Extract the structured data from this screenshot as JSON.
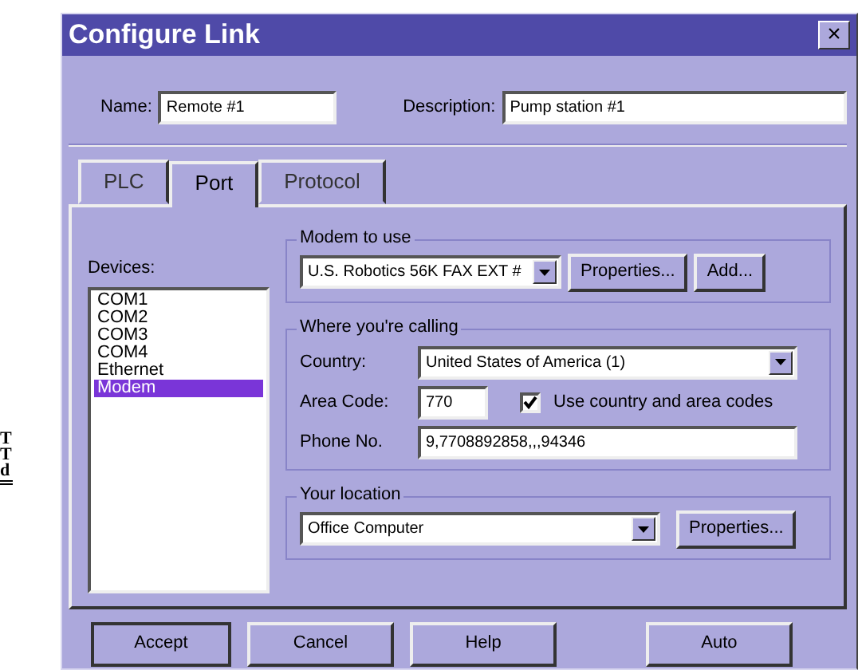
{
  "background_fragments": [
    "T",
    "T",
    "d"
  ],
  "window": {
    "title": "Configure Link",
    "close": "×"
  },
  "name": {
    "label": "Name:",
    "value": "Remote #1"
  },
  "description": {
    "label": "Description:",
    "value": "Pump station #1"
  },
  "tabs": [
    {
      "label": "PLC",
      "selected": false
    },
    {
      "label": "Port",
      "selected": true
    },
    {
      "label": "Protocol",
      "selected": false
    }
  ],
  "devices": {
    "label": "Devices:",
    "items": [
      {
        "label": "COM1",
        "selected": false
      },
      {
        "label": "COM2",
        "selected": false
      },
      {
        "label": "COM3",
        "selected": false
      },
      {
        "label": "COM4",
        "selected": false
      },
      {
        "label": "Ethernet",
        "selected": false
      },
      {
        "label": "Modem",
        "selected": true
      }
    ]
  },
  "modem_group": {
    "title": "Modem to use",
    "value": "U.S. Robotics 56K FAX EXT #",
    "buttons": [
      "Properties...",
      "Add..."
    ]
  },
  "calling_group": {
    "title": "Where you're calling",
    "country_label": "Country:",
    "country": "United States of America (1)",
    "area_label": "Area Code:",
    "area_code": "770",
    "use_codes": {
      "label": "Use country and area codes",
      "checked": true
    },
    "phone_label": "Phone No.",
    "phone": "9,7708892858,,,94346"
  },
  "location_group": {
    "title": "Your location",
    "value": "Office Computer",
    "button": "Properties..."
  },
  "buttons": [
    "Accept",
    "Cancel",
    "Help",
    "Auto"
  ]
}
